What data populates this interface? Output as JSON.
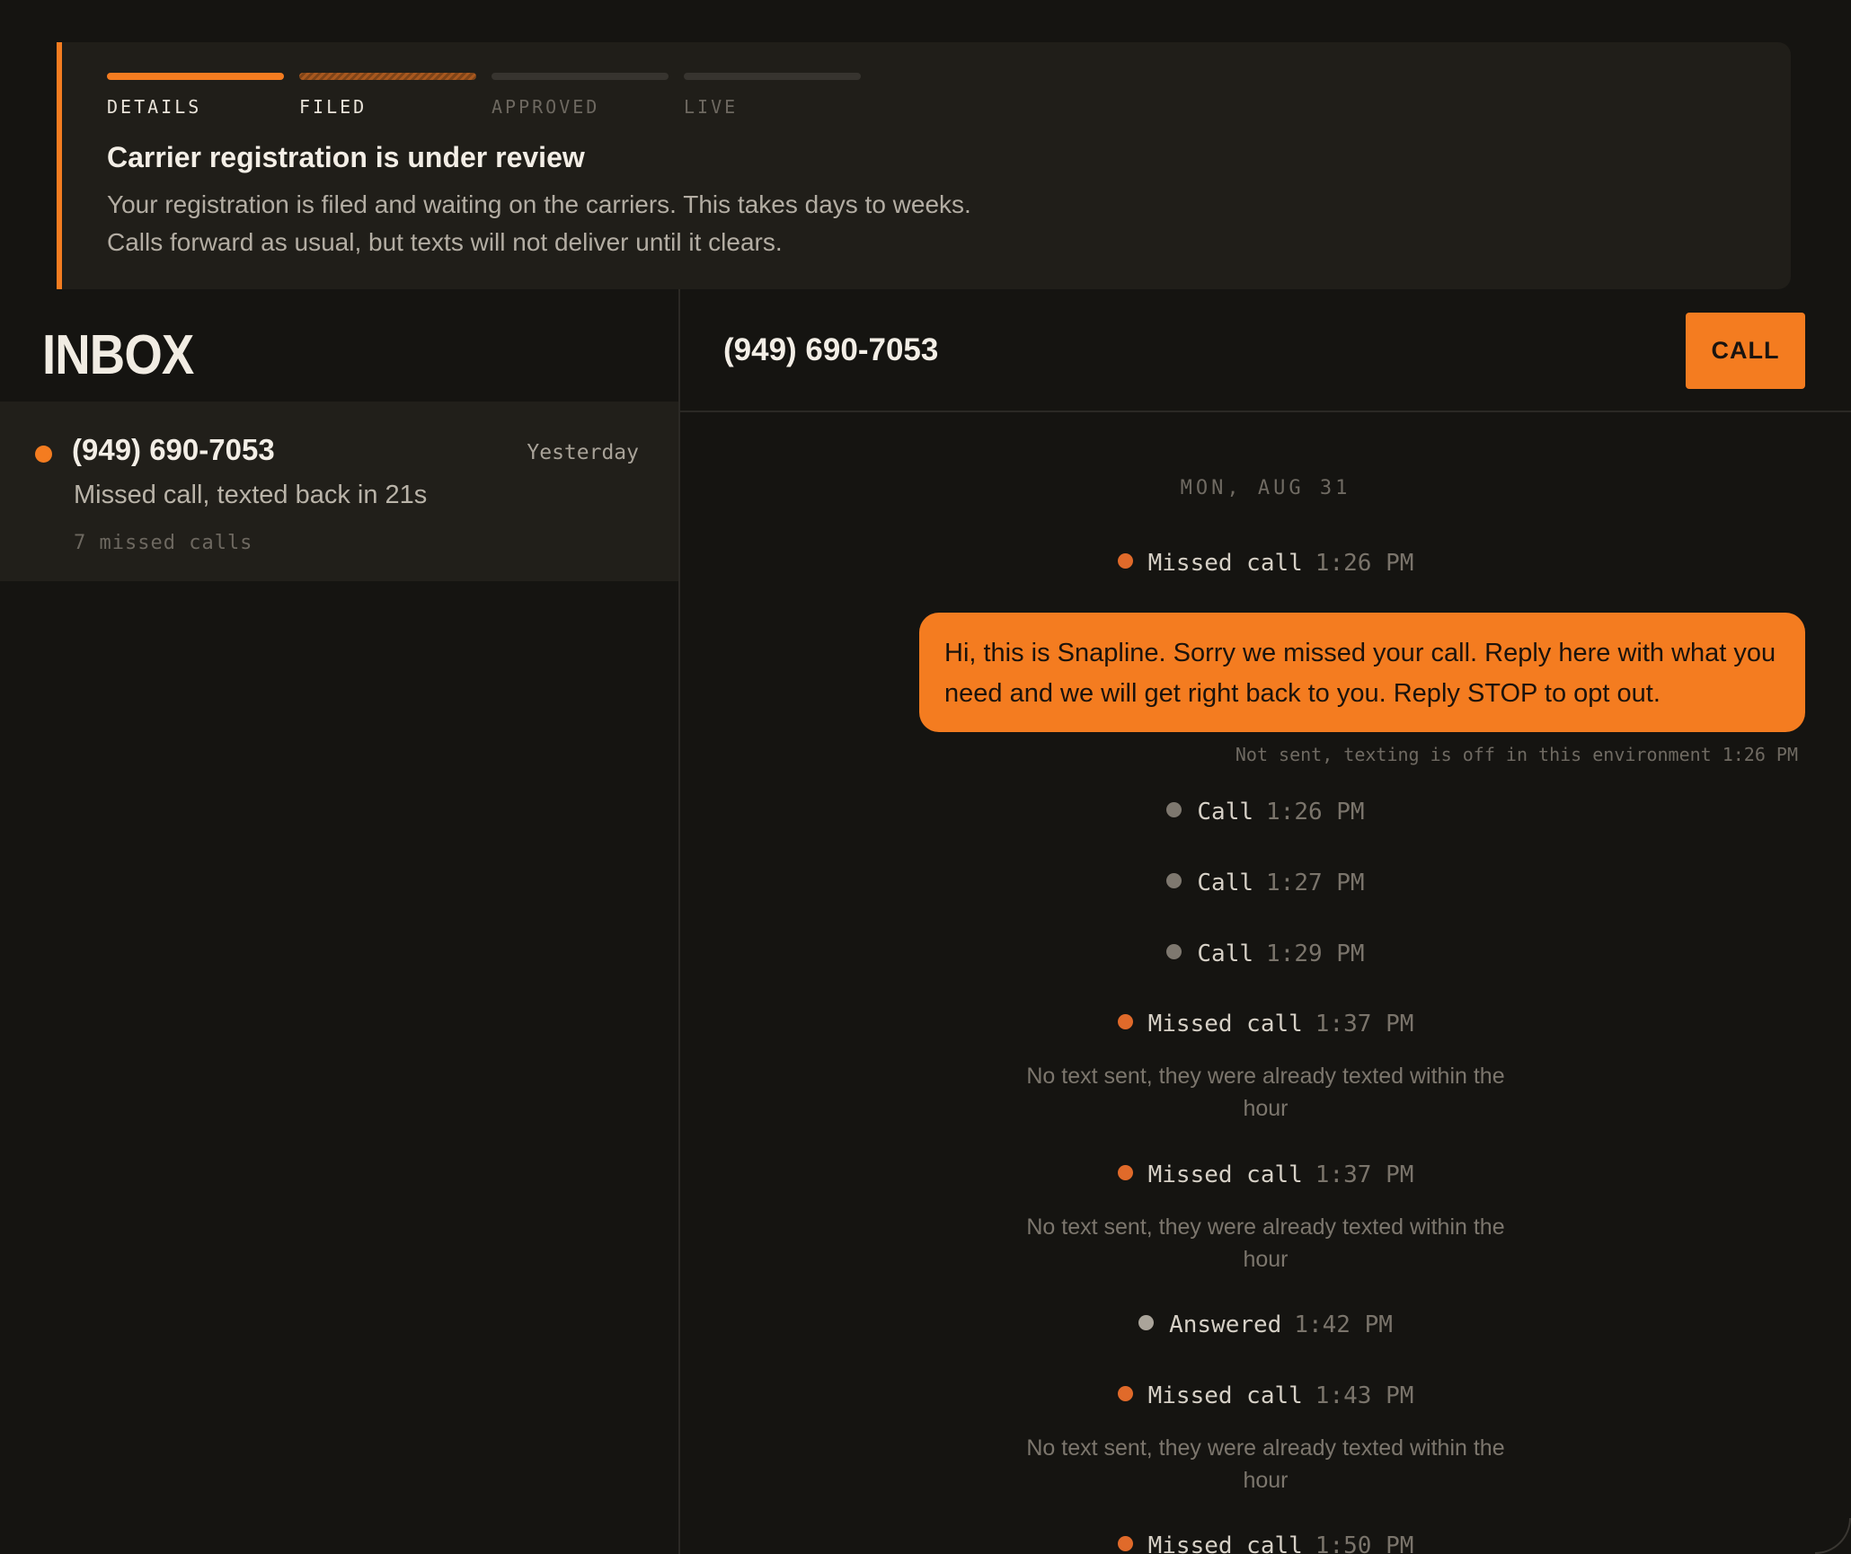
{
  "colors": {
    "accent": "#f47c20",
    "background": "#151411",
    "panel": "#201e19"
  },
  "banner": {
    "steps": [
      {
        "label": "DETAILS",
        "state": "done"
      },
      {
        "label": "FILED",
        "state": "current"
      },
      {
        "label": "APPROVED",
        "state": "pending"
      },
      {
        "label": "LIVE",
        "state": "pending"
      }
    ],
    "title": "Carrier registration is under review",
    "body_line1": "Your registration is filed and waiting on the carriers. This takes days to weeks.",
    "body_line2": "Calls forward as usual, but texts will not deliver until it clears."
  },
  "inbox": {
    "title": "INBOX",
    "conversations": [
      {
        "name": "(949) 690-7053",
        "time": "Yesterday",
        "preview": "Missed call, texted back in 21s",
        "count": "7 missed calls",
        "unread": true
      }
    ]
  },
  "thread": {
    "title": "(949) 690-7053",
    "call_label": "CALL",
    "date_divider": "MON, AUG 31",
    "message": {
      "text": "Hi, this is Snapline. Sorry we missed your call. Reply here with what you need and we will get right back to you. Reply STOP to opt out.",
      "status": "Not sent, texting is off in this environment",
      "time": "1:26 PM"
    },
    "events": [
      {
        "label": "Missed call",
        "time": "1:26 PM",
        "kind": "missed"
      },
      {
        "label": "Call",
        "time": "1:26 PM",
        "kind": "call"
      },
      {
        "label": "Call",
        "time": "1:27 PM",
        "kind": "call"
      },
      {
        "label": "Call",
        "time": "1:29 PM",
        "kind": "call"
      },
      {
        "label": "Missed call",
        "time": "1:37 PM",
        "kind": "missed",
        "note_line1": "No text sent, they were already texted within the",
        "note_line2": "hour"
      },
      {
        "label": "Missed call",
        "time": "1:37 PM",
        "kind": "missed",
        "note_line1": "No text sent, they were already texted within the",
        "note_line2": "hour"
      },
      {
        "label": "Answered",
        "time": "1:42 PM",
        "kind": "answered"
      },
      {
        "label": "Missed call",
        "time": "1:43 PM",
        "kind": "missed",
        "note_line1": "No text sent, they were already texted within the",
        "note_line2": "hour"
      },
      {
        "label": "Missed call",
        "time": "1:50 PM",
        "kind": "missed"
      }
    ]
  }
}
